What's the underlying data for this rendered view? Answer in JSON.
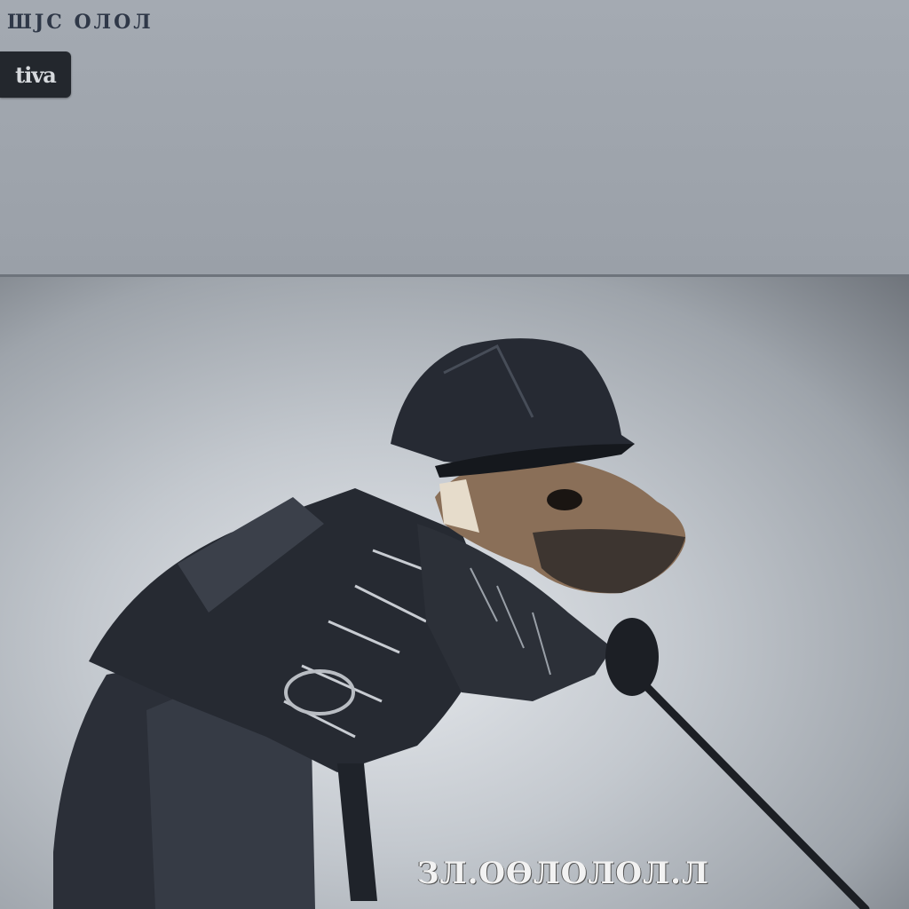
{
  "header": {
    "title": "ШJC ОЛОЛ",
    "badge_text": "tiva"
  },
  "photo": {
    "subject": "dog-in-tactical-gear",
    "caption": "ЗЛ.ОӨЛОЛОЛ.Л"
  },
  "colors": {
    "background": "#9ba1a9",
    "gear": "#23272f",
    "dog_fur": "#8a6f58"
  }
}
